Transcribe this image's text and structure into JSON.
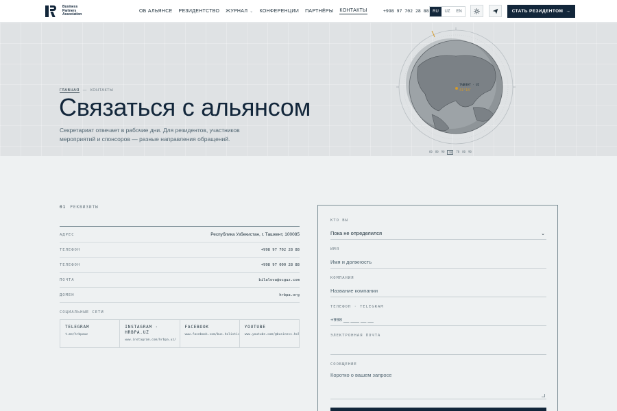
{
  "header": {
    "logo_lines": [
      "Business",
      "Partners",
      "Association"
    ],
    "nav": [
      {
        "label": "ОБ АЛЬЯНСЕ",
        "dropdown": false,
        "active": false
      },
      {
        "label": "РЕЗИДЕНТСТВО",
        "dropdown": false,
        "active": false
      },
      {
        "label": "ЖУРНАЛ",
        "dropdown": true,
        "active": false
      },
      {
        "label": "КОНФЕРЕНЦИИ",
        "dropdown": false,
        "active": false
      },
      {
        "label": "ПАРТНЁРЫ",
        "dropdown": false,
        "active": false
      },
      {
        "label": "КОНТАКТЫ",
        "dropdown": false,
        "active": true
      }
    ],
    "phone": "+998 97 702 28 88",
    "languages": [
      {
        "code": "RU",
        "selected": true
      },
      {
        "code": "UZ",
        "selected": false
      },
      {
        "code": "EN",
        "selected": false
      }
    ],
    "theme_icon": "sun-icon",
    "send_icon": "paper-plane-icon",
    "cta_label": "СТАТЬ РЕЗИДЕНТОМ",
    "cta_arrow": "→"
  },
  "hero": {
    "breadcrumb": {
      "home": "ГЛАВНАЯ",
      "separator": "—",
      "current": "КОНТАКТЫ"
    },
    "title": "Связаться с альянсом",
    "subtitle": "Секретариат отвечает в рабочие дни. Для резидентов, участников мероприятий и спонсоров — разные направления обращений.",
    "globe": {
      "marker_label": "ТАШКЕНТ · UZ",
      "marker_coords": "41°18′",
      "bottom_scale": [
        "60",
        "80",
        "90",
        "40",
        "70",
        "80",
        "90"
      ]
    }
  },
  "requisites": {
    "section_number": "01",
    "section_title": "РЕКВИЗИТЫ",
    "rows": [
      {
        "key": "АДРЕС",
        "value": "Республика Узбекистан, г. Ташкент, 100085"
      },
      {
        "key": "ТЕЛЕФОН",
        "value": "+998 97 702 28 88"
      },
      {
        "key": "ТЕЛЕФОН",
        "value": "+998 97 000 28 88"
      },
      {
        "key": "ПОЧТА",
        "value": "bilalova@ocguz.com"
      },
      {
        "key": "ДОМЕН",
        "value": "hrbpa.org"
      }
    ],
    "social_title": "СОЦИАЛЬНЫЕ СЕТИ",
    "socials": [
      {
        "name": "TELEGRAM",
        "link": "t.me/hrbpauz"
      },
      {
        "name": "INSTAGRAM · HRBPA.UZ",
        "link": "www.instagram.com/hrbpa.uz/"
      },
      {
        "name": "FACEBOOK",
        "link": "www.facebook.com/bus.holistic"
      },
      {
        "name": "YOUTUBE",
        "link": "www.youtube.com/@business.holistic"
      }
    ]
  },
  "form": {
    "who_label": "КТО ВЫ",
    "who_value": "Пока не определился",
    "name_label": "ИМЯ",
    "name_placeholder": "Имя и должность",
    "company_label": "КОМПАНИЯ",
    "company_placeholder": "Название компании",
    "phone_label": "ТЕЛЕФОН · TELEGRAM",
    "phone_placeholder": "+998 __ ___ __ __",
    "email_label": "ЭЛЕКТРОННАЯ ПОЧТА",
    "email_placeholder": "",
    "message_label": "СООБЩЕНИЕ",
    "message_placeholder": "Коротко о вашем запросе"
  },
  "colors": {
    "brand_dark": "#12263a",
    "hero_bg": "#dfe2e4",
    "page_bg": "#eef1f2",
    "accent_marker": "#d39a2a"
  }
}
